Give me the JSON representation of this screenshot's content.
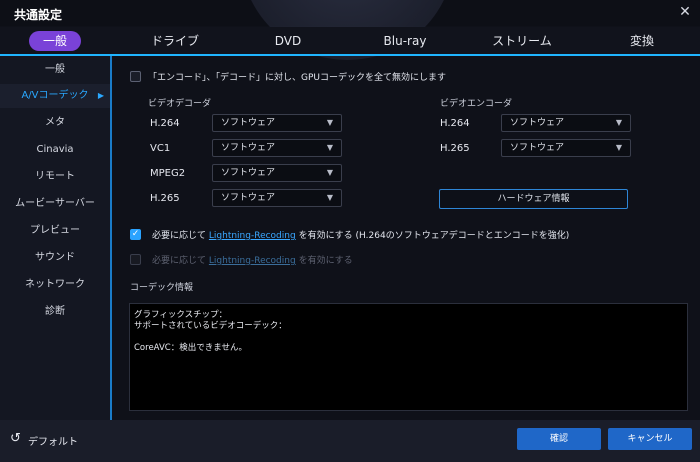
{
  "window": {
    "title": "共通設定",
    "close_glyph": "✕"
  },
  "tabs": [
    {
      "label": "一般"
    },
    {
      "label": "ドライブ"
    },
    {
      "label": "DVD"
    },
    {
      "label": "Blu-ray"
    },
    {
      "label": "ストリーム"
    },
    {
      "label": "変換"
    }
  ],
  "sidebar": {
    "items": [
      {
        "label": "一般"
      },
      {
        "label": "A/Vコーデック"
      },
      {
        "label": "メタ"
      },
      {
        "label": "Cinavia"
      },
      {
        "label": "リモート"
      },
      {
        "label": "ムービーサーバー"
      },
      {
        "label": "プレビュー"
      },
      {
        "label": "サウンド"
      },
      {
        "label": "ネットワーク"
      },
      {
        "label": "診断"
      }
    ],
    "active_marker": "▶"
  },
  "main": {
    "disable_gpu_text": "「エンコード」、「デコード」に対し、GPUコーデックを全て無効にします",
    "video_decoder": {
      "title": "ビデオデコーダ",
      "rows": [
        {
          "codec": "H.264",
          "value": "ソフトウェア"
        },
        {
          "codec": "VC1",
          "value": "ソフトウェア"
        },
        {
          "codec": "MPEG2",
          "value": "ソフトウェア"
        },
        {
          "codec": "H.265",
          "value": "ソフトウェア"
        }
      ]
    },
    "video_encoder": {
      "title": "ビデオエンコーダ",
      "rows": [
        {
          "codec": "H.264",
          "value": "ソフトウェア"
        },
        {
          "codec": "H.265",
          "value": "ソフトウェア"
        }
      ],
      "hw_info_button": "ハードウェア情報"
    },
    "lightning1": {
      "prefix": "必要に応じて",
      "link": "Lightning-Recoding",
      "suffix": "を有効にする (H.264のソフトウェアデコードとエンコードを強化)"
    },
    "lightning2": {
      "prefix": "必要に応じて",
      "link": "Lightning-Recoding",
      "suffix": "を有効にする"
    },
    "codec_info": {
      "title": "コーデック情報",
      "lines": [
        "グラフィックスチップ：",
        "サポートされているビデオコーデック：",
        "",
        "CoreAVC：検出できません。"
      ]
    },
    "select_caret": "▼"
  },
  "footer": {
    "default_icon": "↺",
    "default_label": "デフォルト",
    "ok_label": "確認",
    "cancel_label": "キャンセル"
  },
  "colors": {
    "accent_purple": "#7a42d8",
    "accent_blue": "#20b5ff",
    "button_blue": "#1f67c8"
  }
}
